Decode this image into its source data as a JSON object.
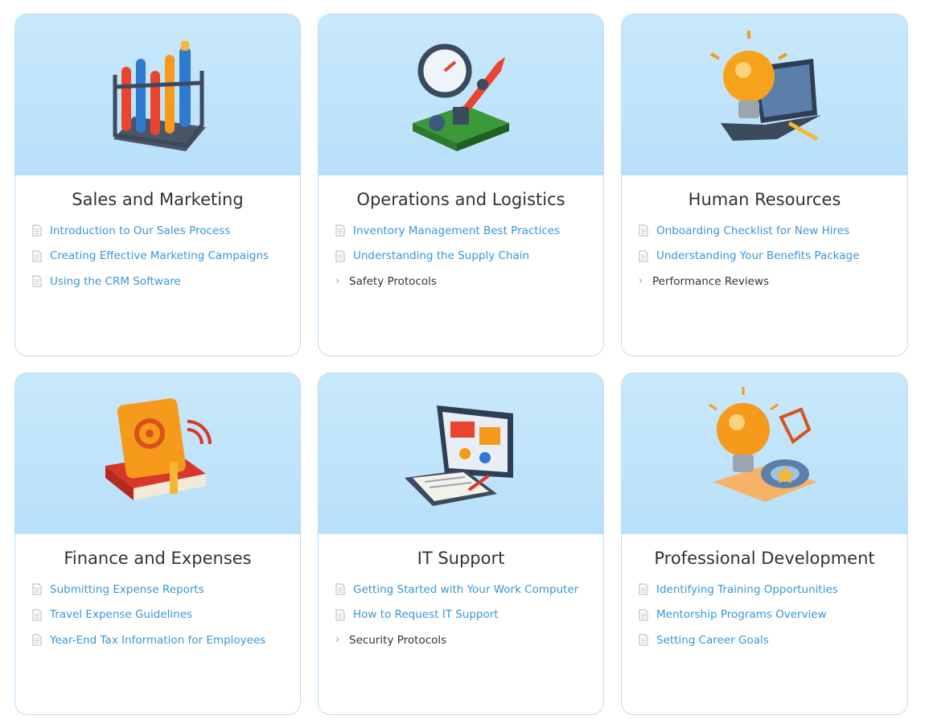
{
  "colors": {
    "card_border": "#b9def5",
    "hero_bg": "#c3e5fb",
    "link": "#3a95d8",
    "title": "#2f3337",
    "chevron": "#e07b7b"
  },
  "cards": [
    {
      "title": "Sales and Marketing",
      "hero_icon": "test-tubes-rack-icon",
      "items": [
        {
          "label": "Introduction to Our Sales Process",
          "icon": "document-icon"
        },
        {
          "label": "Creating Effective Marketing Campaigns",
          "icon": "document-icon"
        },
        {
          "label": "Using the CRM Software",
          "icon": "document-icon"
        }
      ]
    },
    {
      "title": "Operations and Logistics",
      "hero_icon": "rocket-clock-icon",
      "items": [
        {
          "label": "Inventory Management Best Practices",
          "icon": "document-icon"
        },
        {
          "label": "Understanding the Supply Chain",
          "icon": "document-icon"
        },
        {
          "label": "Safety Protocols",
          "icon": "chevron-right-icon"
        }
      ]
    },
    {
      "title": "Human Resources",
      "hero_icon": "lightbulb-laptop-icon",
      "items": [
        {
          "label": "Onboarding Checklist for New Hires",
          "icon": "document-icon"
        },
        {
          "label": "Understanding Your Benefits Package",
          "icon": "document-icon"
        },
        {
          "label": "Performance Reviews",
          "icon": "chevron-right-icon"
        }
      ]
    },
    {
      "title": "Finance and Expenses",
      "hero_icon": "book-gear-icon",
      "items": [
        {
          "label": "Submitting Expense Reports",
          "icon": "document-icon"
        },
        {
          "label": "Travel Expense Guidelines",
          "icon": "document-icon"
        },
        {
          "label": "Year-End Tax Information for Employees",
          "icon": "document-icon"
        }
      ]
    },
    {
      "title": "IT Support",
      "hero_icon": "laptop-screen-icon",
      "items": [
        {
          "label": "Getting Started with Your Work Computer",
          "icon": "document-icon"
        },
        {
          "label": "How to Request IT Support",
          "icon": "document-icon"
        },
        {
          "label": "Security Protocols",
          "icon": "chevron-right-icon"
        }
      ]
    },
    {
      "title": "Professional Development",
      "hero_icon": "lightbulb-target-icon",
      "items": [
        {
          "label": "Identifying Training Opportunities",
          "icon": "document-icon"
        },
        {
          "label": "Mentorship Programs Overview",
          "icon": "document-icon"
        },
        {
          "label": "Setting Career Goals",
          "icon": "document-icon"
        }
      ]
    }
  ]
}
